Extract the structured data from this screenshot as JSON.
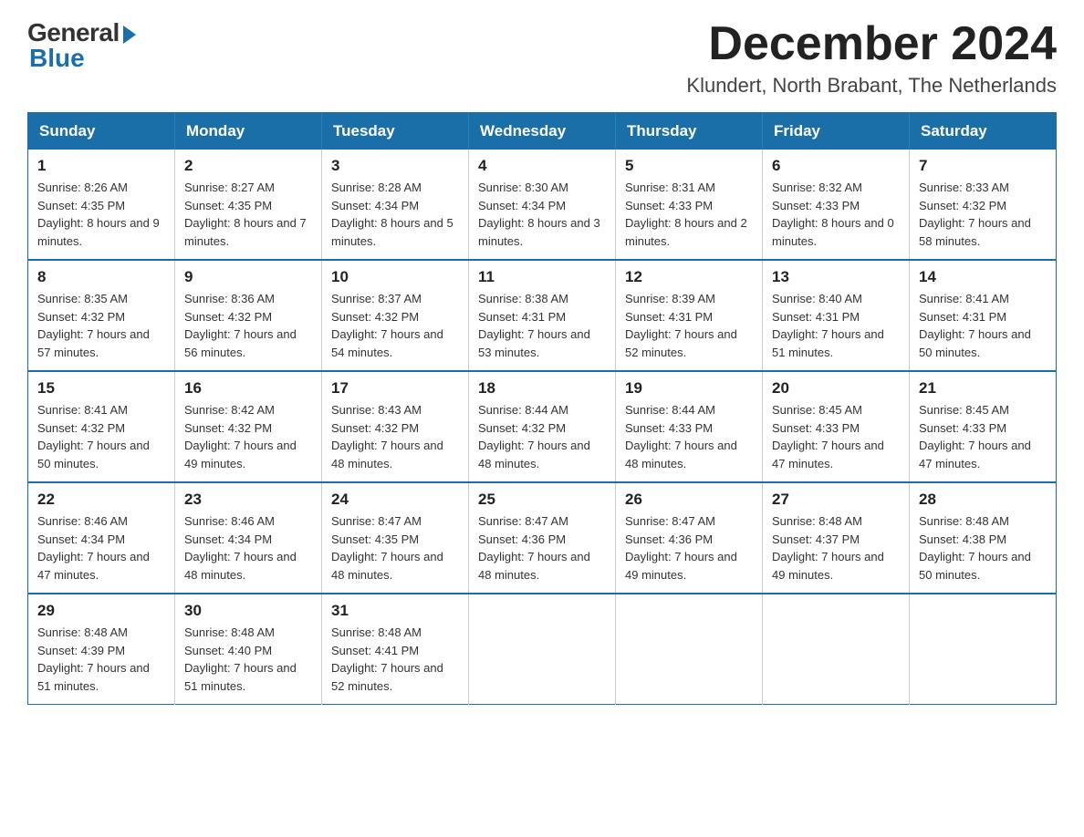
{
  "logo": {
    "general": "General",
    "blue": "Blue"
  },
  "header": {
    "month_year": "December 2024",
    "location": "Klundert, North Brabant, The Netherlands"
  },
  "weekdays": [
    "Sunday",
    "Monday",
    "Tuesday",
    "Wednesday",
    "Thursday",
    "Friday",
    "Saturday"
  ],
  "weeks": [
    [
      {
        "day": "1",
        "sunrise": "8:26 AM",
        "sunset": "4:35 PM",
        "daylight": "8 hours and 9 minutes."
      },
      {
        "day": "2",
        "sunrise": "8:27 AM",
        "sunset": "4:35 PM",
        "daylight": "8 hours and 7 minutes."
      },
      {
        "day": "3",
        "sunrise": "8:28 AM",
        "sunset": "4:34 PM",
        "daylight": "8 hours and 5 minutes."
      },
      {
        "day": "4",
        "sunrise": "8:30 AM",
        "sunset": "4:34 PM",
        "daylight": "8 hours and 3 minutes."
      },
      {
        "day": "5",
        "sunrise": "8:31 AM",
        "sunset": "4:33 PM",
        "daylight": "8 hours and 2 minutes."
      },
      {
        "day": "6",
        "sunrise": "8:32 AM",
        "sunset": "4:33 PM",
        "daylight": "8 hours and 0 minutes."
      },
      {
        "day": "7",
        "sunrise": "8:33 AM",
        "sunset": "4:32 PM",
        "daylight": "7 hours and 58 minutes."
      }
    ],
    [
      {
        "day": "8",
        "sunrise": "8:35 AM",
        "sunset": "4:32 PM",
        "daylight": "7 hours and 57 minutes."
      },
      {
        "day": "9",
        "sunrise": "8:36 AM",
        "sunset": "4:32 PM",
        "daylight": "7 hours and 56 minutes."
      },
      {
        "day": "10",
        "sunrise": "8:37 AM",
        "sunset": "4:32 PM",
        "daylight": "7 hours and 54 minutes."
      },
      {
        "day": "11",
        "sunrise": "8:38 AM",
        "sunset": "4:31 PM",
        "daylight": "7 hours and 53 minutes."
      },
      {
        "day": "12",
        "sunrise": "8:39 AM",
        "sunset": "4:31 PM",
        "daylight": "7 hours and 52 minutes."
      },
      {
        "day": "13",
        "sunrise": "8:40 AM",
        "sunset": "4:31 PM",
        "daylight": "7 hours and 51 minutes."
      },
      {
        "day": "14",
        "sunrise": "8:41 AM",
        "sunset": "4:31 PM",
        "daylight": "7 hours and 50 minutes."
      }
    ],
    [
      {
        "day": "15",
        "sunrise": "8:41 AM",
        "sunset": "4:32 PM",
        "daylight": "7 hours and 50 minutes."
      },
      {
        "day": "16",
        "sunrise": "8:42 AM",
        "sunset": "4:32 PM",
        "daylight": "7 hours and 49 minutes."
      },
      {
        "day": "17",
        "sunrise": "8:43 AM",
        "sunset": "4:32 PM",
        "daylight": "7 hours and 48 minutes."
      },
      {
        "day": "18",
        "sunrise": "8:44 AM",
        "sunset": "4:32 PM",
        "daylight": "7 hours and 48 minutes."
      },
      {
        "day": "19",
        "sunrise": "8:44 AM",
        "sunset": "4:33 PM",
        "daylight": "7 hours and 48 minutes."
      },
      {
        "day": "20",
        "sunrise": "8:45 AM",
        "sunset": "4:33 PM",
        "daylight": "7 hours and 47 minutes."
      },
      {
        "day": "21",
        "sunrise": "8:45 AM",
        "sunset": "4:33 PM",
        "daylight": "7 hours and 47 minutes."
      }
    ],
    [
      {
        "day": "22",
        "sunrise": "8:46 AM",
        "sunset": "4:34 PM",
        "daylight": "7 hours and 47 minutes."
      },
      {
        "day": "23",
        "sunrise": "8:46 AM",
        "sunset": "4:34 PM",
        "daylight": "7 hours and 48 minutes."
      },
      {
        "day": "24",
        "sunrise": "8:47 AM",
        "sunset": "4:35 PM",
        "daylight": "7 hours and 48 minutes."
      },
      {
        "day": "25",
        "sunrise": "8:47 AM",
        "sunset": "4:36 PM",
        "daylight": "7 hours and 48 minutes."
      },
      {
        "day": "26",
        "sunrise": "8:47 AM",
        "sunset": "4:36 PM",
        "daylight": "7 hours and 49 minutes."
      },
      {
        "day": "27",
        "sunrise": "8:48 AM",
        "sunset": "4:37 PM",
        "daylight": "7 hours and 49 minutes."
      },
      {
        "day": "28",
        "sunrise": "8:48 AM",
        "sunset": "4:38 PM",
        "daylight": "7 hours and 50 minutes."
      }
    ],
    [
      {
        "day": "29",
        "sunrise": "8:48 AM",
        "sunset": "4:39 PM",
        "daylight": "7 hours and 51 minutes."
      },
      {
        "day": "30",
        "sunrise": "8:48 AM",
        "sunset": "4:40 PM",
        "daylight": "7 hours and 51 minutes."
      },
      {
        "day": "31",
        "sunrise": "8:48 AM",
        "sunset": "4:41 PM",
        "daylight": "7 hours and 52 minutes."
      },
      null,
      null,
      null,
      null
    ]
  ],
  "labels": {
    "sunrise": "Sunrise:",
    "sunset": "Sunset:",
    "daylight": "Daylight:"
  }
}
